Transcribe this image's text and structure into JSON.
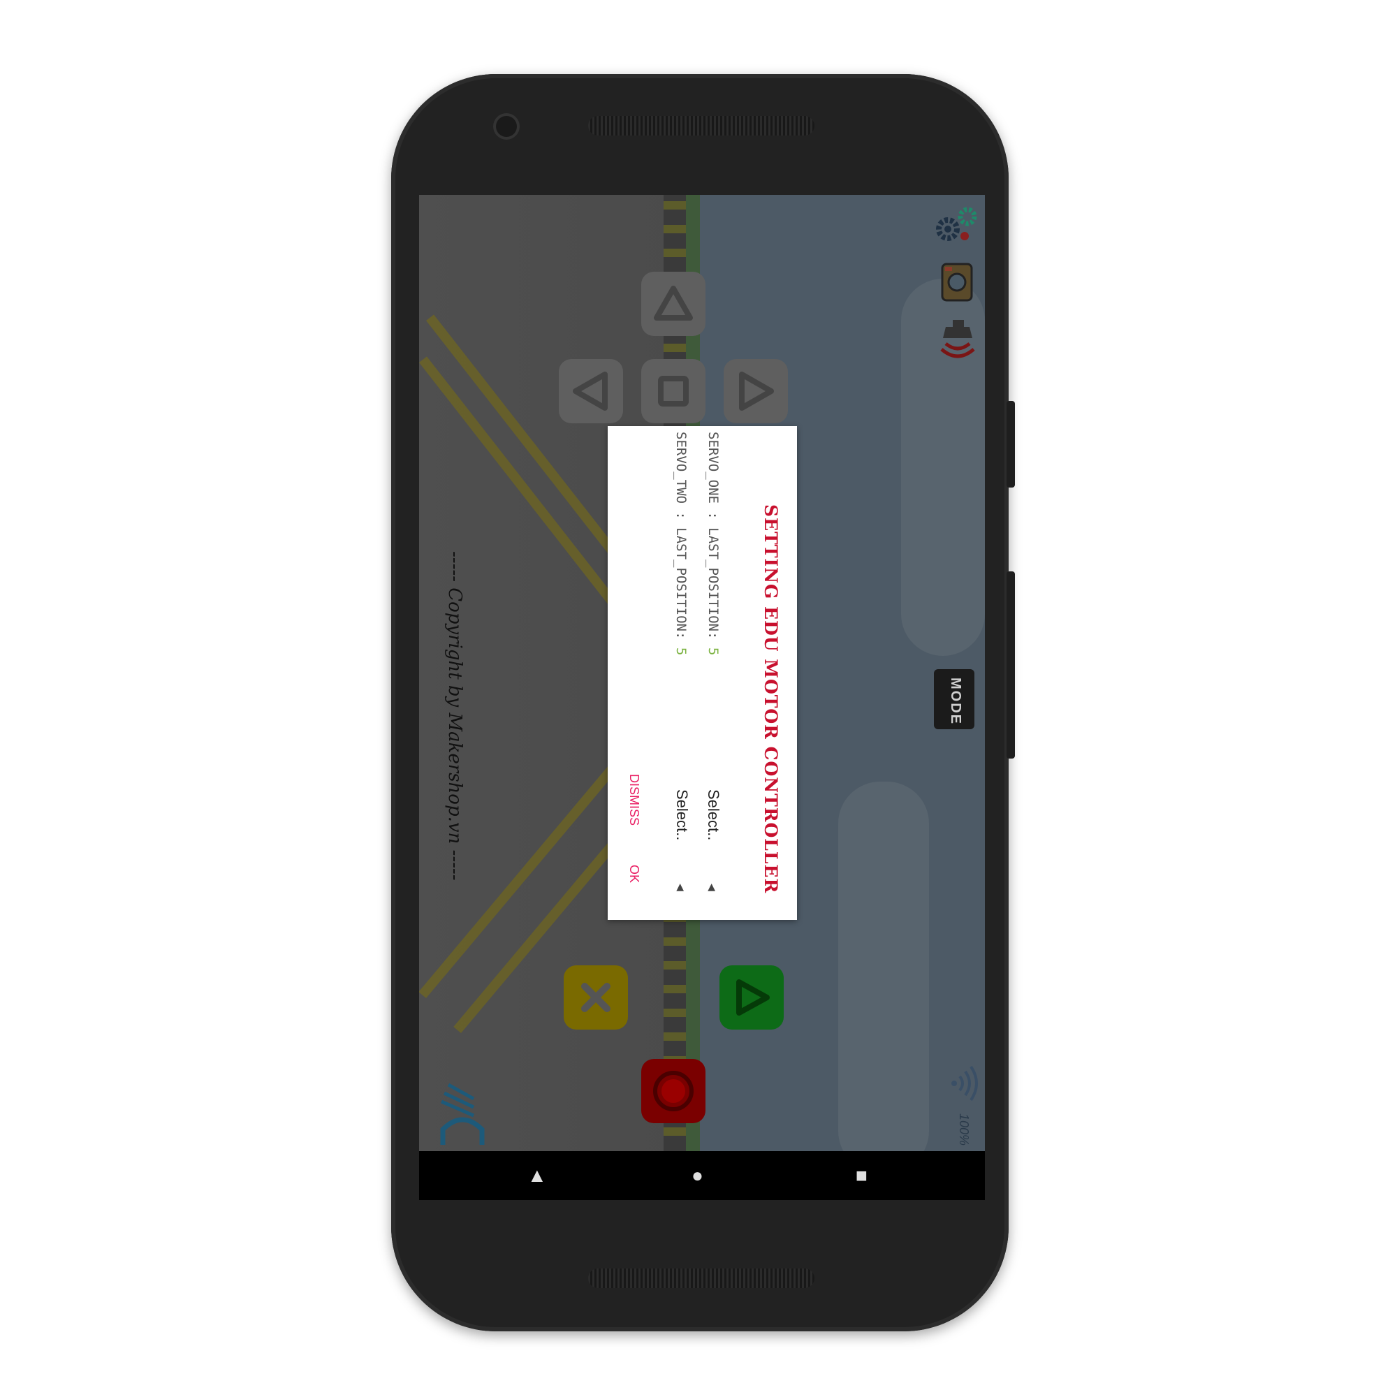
{
  "dialog": {
    "title": "SETTING EDU MOTOR CONTROLLER",
    "servo_one_label": "SERVO_ONE : LAST_POSITION:",
    "servo_one_value": "5",
    "servo_two_label": "SERVO_TWO : LAST_POSITION:",
    "servo_two_value": "5",
    "select_one": "Select..",
    "select_two": "Select..",
    "dismiss": "DISMISS",
    "ok": "OK"
  },
  "app": {
    "copyright": "----- Copyright by Makershop.vn -----",
    "mode_label": "MODE",
    "signal_percent": "100%"
  },
  "icons": {
    "settings": "gears-icon",
    "camera": "camera-icon",
    "horn": "horn-icon",
    "headlight": "headlight-icon",
    "signal": "wifi-signal-icon"
  },
  "navbar": {
    "back": "▲",
    "home": "●",
    "recents": "■"
  },
  "colors": {
    "title": "#c8102e",
    "value": "#7cb342",
    "action": "#e91e63"
  }
}
